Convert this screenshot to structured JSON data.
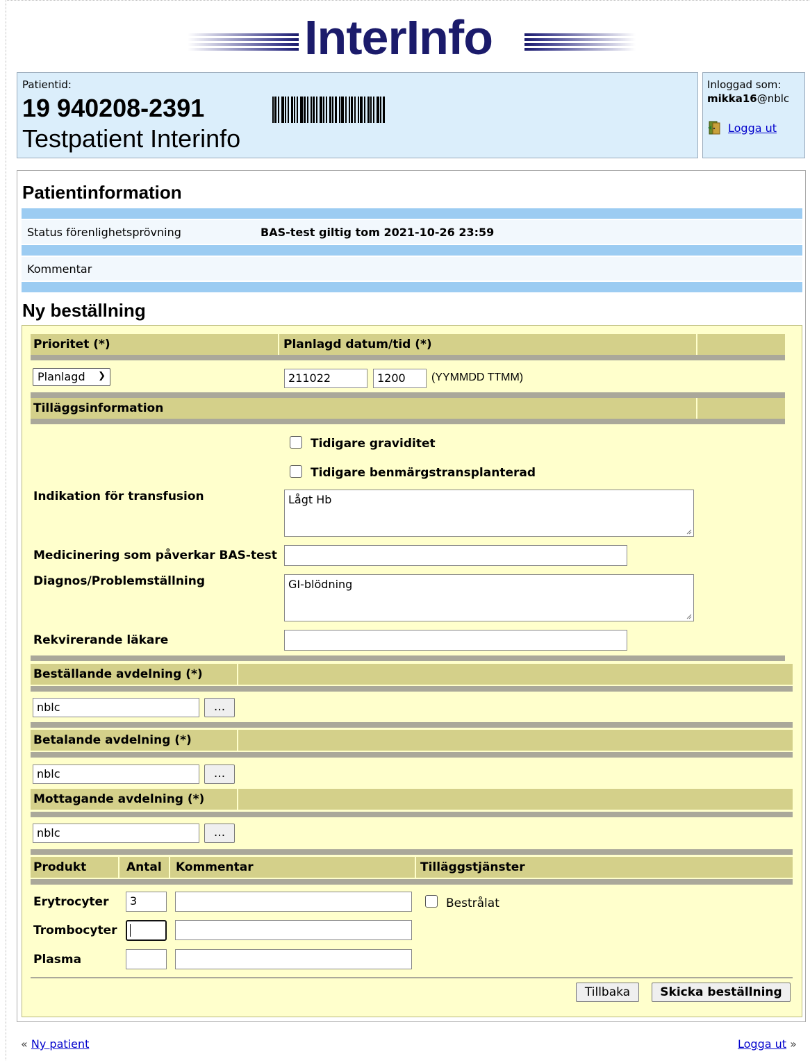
{
  "logo": {
    "text": "InterInfo"
  },
  "patient": {
    "label": "Patientid:",
    "id": "19 940208-2391",
    "name": "Testpatient Interinfo"
  },
  "login": {
    "label": "Inloggad som:",
    "user": "mikka16",
    "domain": "@nblc",
    "logout": "Logga ut"
  },
  "patientinfo": {
    "title": "Patientinformation",
    "status_label": "Status förenlighetsprövning",
    "status_value": "BAS-test giltig tom 2021-10-26 23:59",
    "comment_label": "Kommentar"
  },
  "order": {
    "title": "Ny beställning",
    "priority_header": "Prioritet (*)",
    "planned_header": "Planlagd datum/tid (*)",
    "priority_value": "Planlagd",
    "date_value": "211022",
    "time_value": "1200",
    "date_format": "(YYMMDD TTMM)",
    "extra_header": "Tilläggsinformation",
    "prev_pregnancy": "Tidigare graviditet",
    "prev_transplant": "Tidigare benmärgstransplanterad",
    "indication_label": "Indikation för transfusion",
    "indication_value": "Lågt Hb",
    "medication_label": "Medicinering som påverkar BAS-test",
    "medication_value": "",
    "diagnosis_label": "Diagnos/Problemställning",
    "diagnosis_value": "GI-blödning",
    "doctor_label": "Rekvirerande läkare",
    "doctor_value": "",
    "ordering_dept_header": "Beställande avdelning (*)",
    "ordering_dept_value": "nblc",
    "paying_dept_header": "Betalande avdelning (*)",
    "paying_dept_value": "nblc",
    "receiving_dept_header": "Mottagande avdelning (*)",
    "receiving_dept_value": "nblc",
    "browse_label": "...",
    "products_header": {
      "product": "Produkt",
      "amount": "Antal",
      "comment": "Kommentar",
      "services": "Tilläggstjänster"
    },
    "products": [
      {
        "name": "Erytrocyter",
        "amount": "3",
        "comment": ""
      },
      {
        "name": "Trombocyter",
        "amount": "",
        "comment": ""
      },
      {
        "name": "Plasma",
        "amount": "",
        "comment": ""
      }
    ],
    "irradiated_label": "Bestrålat",
    "back_button": "Tillbaka",
    "submit_button": "Skicka beställning"
  },
  "footer": {
    "new_patient": "Ny patient",
    "logout": "Logga ut",
    "left_prefix": "«",
    "right_suffix": "»"
  },
  "colors": {
    "header_blue": "#dbeefb",
    "bar_blue": "#9cccf2",
    "form_yellow": "#ffffcc",
    "header_khaki": "#d4d08a",
    "logo_navy": "#1b1b6b",
    "link": "#0000cc"
  }
}
